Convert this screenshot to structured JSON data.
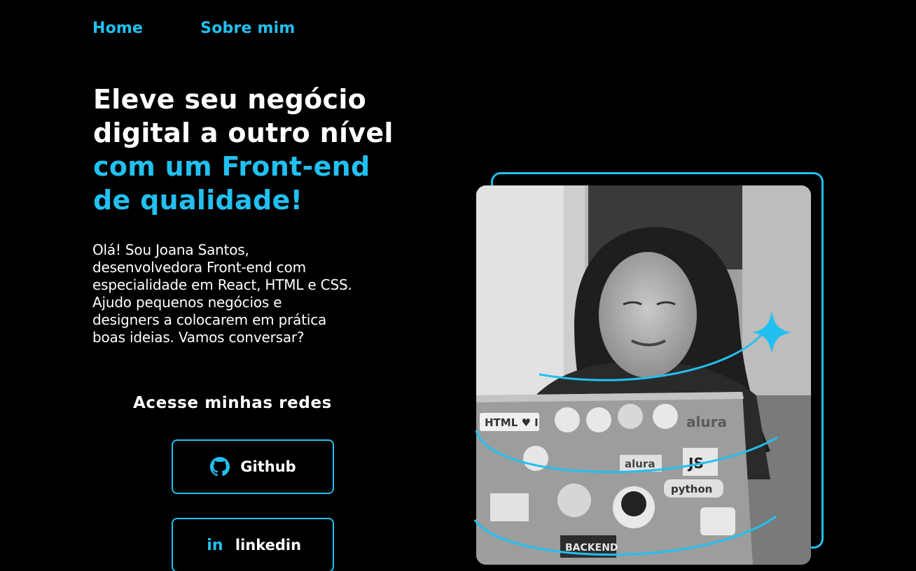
{
  "nav": {
    "home": "Home",
    "about": "Sobre mim"
  },
  "hero": {
    "headline_white": [
      "Eleve seu negócio",
      "digital a outro nível"
    ],
    "headline_blue": [
      "com um Front-end",
      "de qualidade!"
    ],
    "bio_lines": [
      "Olá! Sou Joana Santos,",
      "desenvolvedora Front-end com",
      "especialidade em React, HTML e CSS.",
      "Ajudo pequenos negócios e",
      "designers a colocarem em prática",
      "boas ideias. Vamos conversar?"
    ]
  },
  "social": {
    "title": "Acesse minhas redes",
    "github_label": "Github",
    "github_icon": "github-icon",
    "linkedin_label": "linkedin",
    "linkedin_icon_text": "in",
    "linkedin_icon": "linkedin-icon"
  },
  "photo": {
    "laptop_sticker_text": [
      "HTML ♥ I",
      "alura",
      "JS",
      "python",
      "alura",
      "BACKEND"
    ]
  },
  "colors": {
    "background": "#000000",
    "accent": "#22c0f0",
    "text": "#ffffff"
  }
}
